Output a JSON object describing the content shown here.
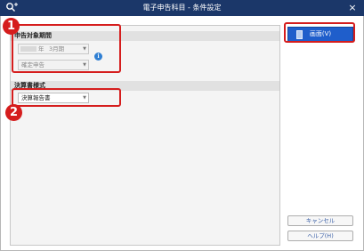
{
  "window": {
    "title": "電子申告科目 - 条件設定",
    "close_label": "×"
  },
  "period_section": {
    "header": "申告対象期間",
    "year_suffix": "年",
    "month_value": "3月期",
    "type_value": "確定申告",
    "info_label": "i"
  },
  "format_section": {
    "header": "決算書様式",
    "value": "決算報告書"
  },
  "callouts": {
    "one": "1",
    "two": "2"
  },
  "buttons": {
    "print": "画面(V)",
    "cancel": "キャンセル",
    "help": "ヘルプ(H)"
  },
  "colors": {
    "titlebar": "#1b3769",
    "accent": "#1f5ecb",
    "callout": "#d51d1d"
  }
}
